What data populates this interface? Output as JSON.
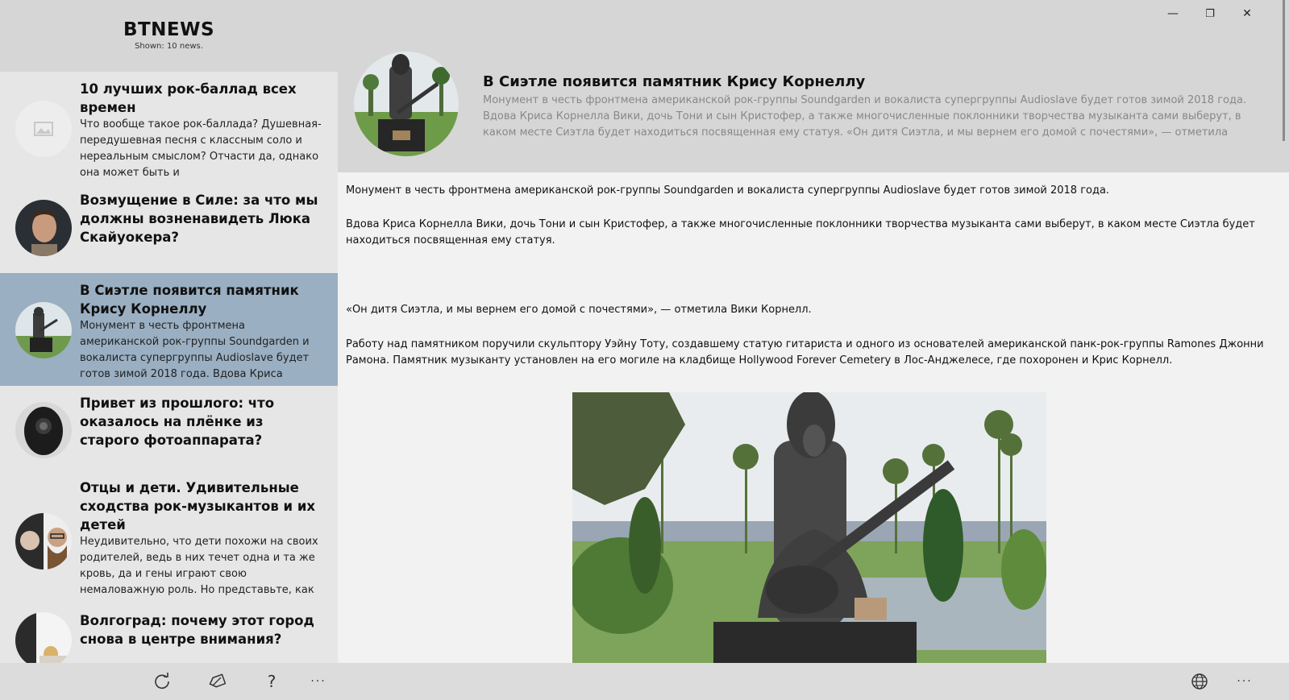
{
  "app": {
    "title": "BTNEWS",
    "shown": "Shown: 10 news."
  },
  "news": [
    {
      "title": "10 лучших рок-баллад всех времен",
      "summary": "Что вообще такое рок-баллада? Душевная-передушевная песня с классным соло и нереальным смыслом? Отчасти да, однако она может быть и",
      "thumb": "image-placeholder-icon"
    },
    {
      "title": "Возмущение в Силе: за что мы должны возненавидеть Люка Скайуокера?",
      "summary": "",
      "thumb": "portrait"
    },
    {
      "title": "В Сиэтле появится памятник Крису Корнеллу",
      "summary": "Монумент в честь фронтмена американской рок-группы Soundgarden и вокалиста супергруппы Audioslave будет готов зимой 2018 года. Вдова Криса",
      "thumb": "statue",
      "selected": true
    },
    {
      "title": "Привет из прошлого: что оказалось на плёнке из старого фотоаппарата?",
      "summary": "",
      "thumb": "camera"
    },
    {
      "title": "Отцы и дети. Удивительные сходства рок-музыкантов и их детей",
      "summary": "Неудивительно, что дети похожи на своих родителей, ведь в них течет одна и та же кровь, да и гены играют свою немаловажную роль. Но представьте, как",
      "thumb": "portraits"
    },
    {
      "title": "Волгоград: почему этот город снова в центре внимания?",
      "summary": "",
      "thumb": "city"
    }
  ],
  "sidebar_bar": {
    "refresh_icon": "refresh-icon",
    "tag_icon": "tag-icon",
    "help_label": "?",
    "more_label": "···"
  },
  "main_bar": {
    "globe_icon": "globe-icon",
    "more_label": "···"
  },
  "window": {
    "minimize": "—",
    "restore": "❐",
    "close": "✕"
  },
  "article": {
    "title": "В Сиэтле появится памятник Крису Корнеллу",
    "summary": "Монумент в честь фронтмена американской рок-группы Soundgarden и вокалиста супергруппы Audioslave будет готов зимой 2018 года. Вдова Криса Корнелла Вики, дочь Тони и сын Кристофер, а также многочисленные поклонники творчества музыканта сами выберут, в каком месте Сиэтла будет находиться посвященная ему статуя. «Он дитя Сиэтла, и мы вернем его домой с почестями», — отметила Вики",
    "paragraphs": [
      "Монумент в честь фронтмена американской рок-группы Soundgarden и вокалиста супергруппы Audioslave будет готов зимой 2018 года.",
      "Вдова Криса Корнелла Вики, дочь Тони и сын Кристофер, а также многочисленные поклонники творчества музыканта сами выберут, в каком месте Сиэтла будет находиться посвященная ему статуя.",
      "«Он дитя Сиэтла, и мы вернем его домой с почестями», — отметила Вики Корнелл.",
      "Работу над памятником поручили скульптору Уэйну Тоту, создавшему статую гитариста и одного из основателей американской панк-рок-группы Ramones Джонни Рамона. Памятник музыканту установлен на его могиле на кладбище Hollywood Forever Cemetery в Лос-Анджелесе, где похоронен и Крис Корнелл."
    ]
  }
}
